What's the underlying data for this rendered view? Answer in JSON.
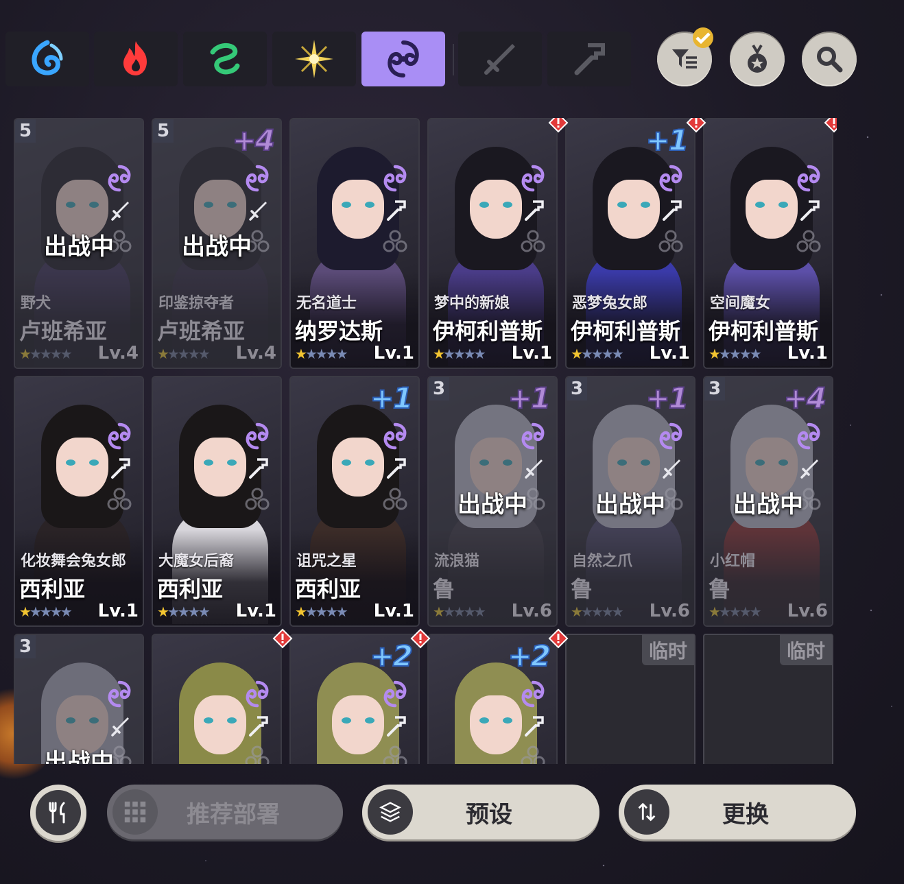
{
  "element_tabs": [
    {
      "icon": "water-element-icon",
      "active": false,
      "color": "#3aa6ff"
    },
    {
      "icon": "fire-element-icon",
      "active": false,
      "color": "#ff4a4a"
    },
    {
      "icon": "wind-element-icon",
      "active": false,
      "color": "#3fd27a"
    },
    {
      "icon": "light-element-icon",
      "active": false,
      "color": "#f3d35a"
    },
    {
      "icon": "dark-element-icon",
      "active": true,
      "color": "#6a3fd6"
    },
    {
      "icon": "sword-class-icon",
      "active": false,
      "color": "#555"
    },
    {
      "icon": "hammer-class-icon",
      "active": false,
      "color": "#555"
    }
  ],
  "toolbar": {
    "filter_icon": "filter-icon",
    "medal_icon": "medal-icon",
    "search_icon": "search-icon"
  },
  "cards": [
    {
      "rank": "5",
      "plus": "",
      "title": "野犬",
      "name": "卢班希亚",
      "stars": 1,
      "level": "Lv.4",
      "deployed": true,
      "deploy_text": "出战中",
      "alert": false,
      "weapon": "sword",
      "hair": "#1c1a22",
      "outfit": "#3a2f55"
    },
    {
      "rank": "5",
      "plus": "+4",
      "title": "印鉴掠夺者",
      "name": "卢班希亚",
      "stars": 1,
      "level": "Lv.4",
      "deployed": true,
      "deploy_text": "出战中",
      "alert": false,
      "weapon": "sword",
      "hair": "#1c1a22",
      "outfit": "#30283f"
    },
    {
      "rank": "",
      "plus": "",
      "title": "无名道士",
      "name": "纳罗达斯",
      "stars": 1,
      "level": "Lv.1",
      "deployed": false,
      "deploy_text": "",
      "alert": false,
      "weapon": "hammer",
      "hair": "#1d1b2e",
      "outfit": "#5b4b78"
    },
    {
      "rank": "",
      "plus": "",
      "title": "梦中的新娘",
      "name": "伊柯利普斯",
      "stars": 1,
      "level": "Lv.1",
      "deployed": false,
      "deploy_text": "",
      "alert": true,
      "weapon": "hammer",
      "hair": "#1a1820",
      "outfit": "#4a3c88"
    },
    {
      "rank": "",
      "plus": "+1",
      "title": "恶梦兔女郎",
      "name": "伊柯利普斯",
      "stars": 1,
      "level": "Lv.1",
      "deployed": false,
      "deploy_text": "",
      "alert": true,
      "weapon": "hammer",
      "hair": "#1a1820",
      "outfit": "#3a3aa8"
    },
    {
      "rank": "",
      "plus": "",
      "title": "空间魔女",
      "name": "伊柯利普斯",
      "stars": 1,
      "level": "Lv.1",
      "deployed": false,
      "deploy_text": "",
      "alert": true,
      "weapon": "hammer",
      "hair": "#1a1820",
      "outfit": "#5c4fa8"
    },
    {
      "rank": "",
      "plus": "",
      "title": "化妆舞会兔女郎",
      "name": "西利亚",
      "stars": 1,
      "level": "Lv.1",
      "deployed": false,
      "deploy_text": "",
      "alert": false,
      "weapon": "hammer",
      "hair": "#1a1718",
      "outfit": "#2a2326"
    },
    {
      "rank": "",
      "plus": "",
      "title": "大魔女后裔",
      "name": "西利亚",
      "stars": 1,
      "level": "Lv.1",
      "deployed": false,
      "deploy_text": "",
      "alert": false,
      "weapon": "hammer",
      "hair": "#1a1718",
      "outfit": "#d8d6dc"
    },
    {
      "rank": "",
      "plus": "+1",
      "title": "诅咒之星",
      "name": "西利亚",
      "stars": 1,
      "level": "Lv.1",
      "deployed": false,
      "deploy_text": "",
      "alert": false,
      "weapon": "hammer",
      "hair": "#1a1718",
      "outfit": "#3c2c28"
    },
    {
      "rank": "3",
      "plus": "+1",
      "title": "流浪猫",
      "name": "鲁",
      "stars": 1,
      "level": "Lv.6",
      "deployed": true,
      "deploy_text": "出战中",
      "alert": false,
      "weapon": "sword",
      "hair": "#b8b8c8",
      "outfit": "#3a3540"
    },
    {
      "rank": "3",
      "plus": "+1",
      "title": "自然之爪",
      "name": "鲁",
      "stars": 1,
      "level": "Lv.6",
      "deployed": true,
      "deploy_text": "出战中",
      "alert": false,
      "weapon": "sword",
      "hair": "#b8b8c8",
      "outfit": "#4a4568"
    },
    {
      "rank": "3",
      "plus": "+4",
      "title": "小红帽",
      "name": "鲁",
      "stars": 1,
      "level": "Lv.6",
      "deployed": true,
      "deploy_text": "出战中",
      "alert": false,
      "weapon": "sword",
      "hair": "#b8b8c8",
      "outfit": "#8a2a2a"
    },
    {
      "rank": "3",
      "plus": "",
      "title": "",
      "name": "",
      "stars": 0,
      "level": "",
      "deployed": true,
      "deploy_text": "出战中",
      "alert": false,
      "weapon": "sword",
      "hair": "#a8a8b8",
      "outfit": "#3a3540"
    },
    {
      "rank": "",
      "plus": "",
      "title": "",
      "name": "",
      "stars": 0,
      "level": "",
      "deployed": false,
      "deploy_text": "",
      "alert": true,
      "weapon": "hammer",
      "hair": "#8a8a48",
      "outfit": "#3a2a6a"
    },
    {
      "rank": "",
      "plus": "+2",
      "title": "",
      "name": "",
      "stars": 0,
      "level": "",
      "deployed": false,
      "deploy_text": "",
      "alert": true,
      "weapon": "hammer",
      "hair": "#8f8e52",
      "outfit": "#e8e2e8"
    },
    {
      "rank": "",
      "plus": "+2",
      "title": "",
      "name": "",
      "stars": 0,
      "level": "",
      "deployed": false,
      "deploy_text": "",
      "alert": true,
      "weapon": "hammer",
      "hair": "#8f8e52",
      "outfit": "#3a2a2e"
    }
  ],
  "empty_slots": [
    {
      "label": "临时"
    },
    {
      "label": "临时"
    }
  ],
  "bottom": {
    "food_icon": "utensils-icon",
    "recommend_label": "推荐部署",
    "preset_label": "预设",
    "swap_label": "更换"
  },
  "colors": {
    "accent": "#a98ef5",
    "star": "#f3c531",
    "alert": "#e23a3a"
  }
}
